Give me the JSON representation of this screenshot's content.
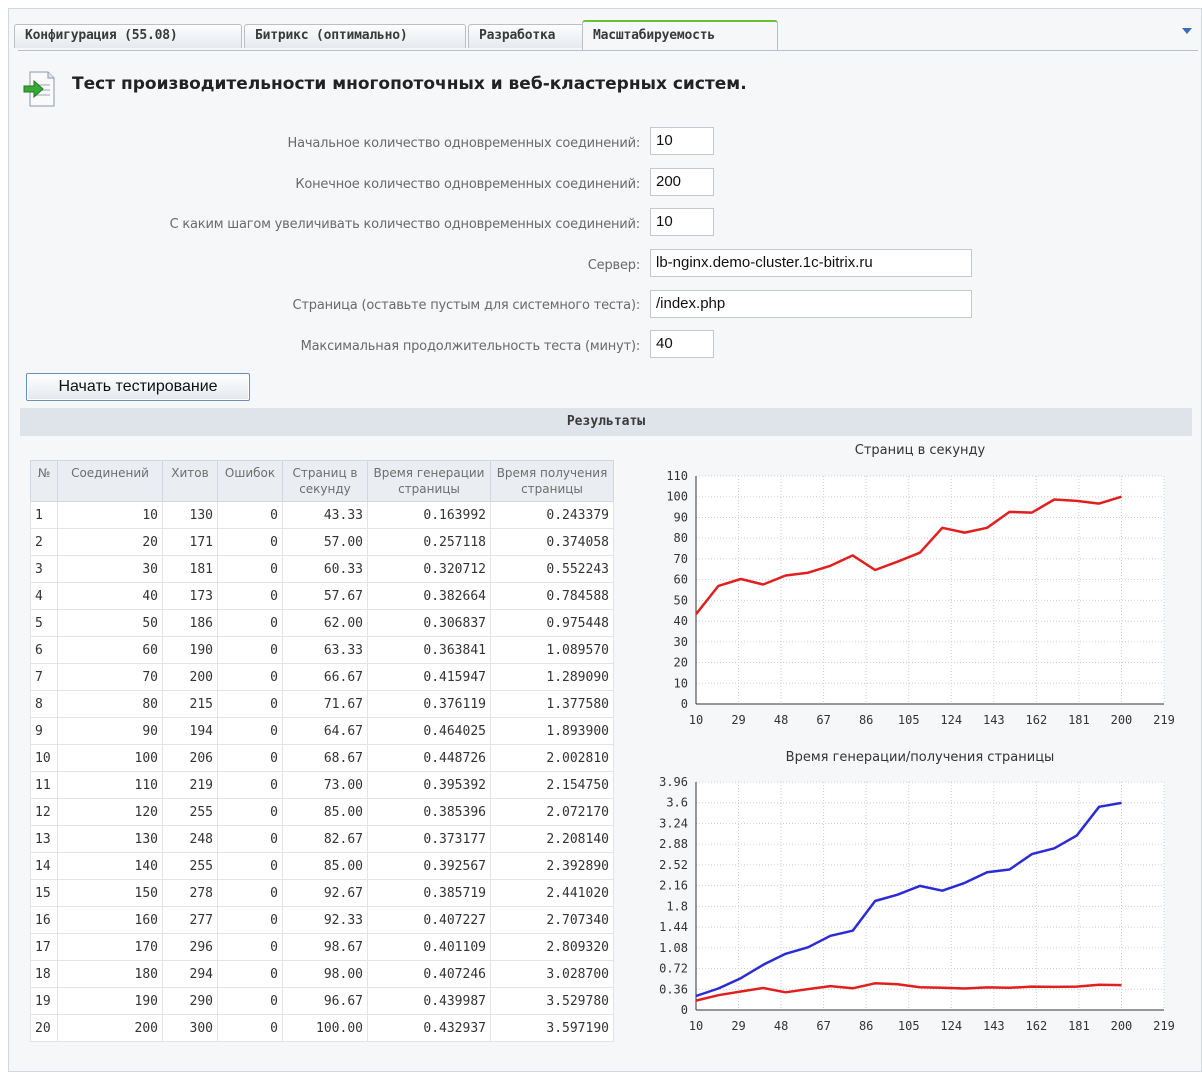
{
  "tabs": [
    {
      "label": "Конфигурация (55.08)"
    },
    {
      "label": "Битрикс (оптимально)"
    },
    {
      "label": "Разработка"
    },
    {
      "label": "Масштабируемость"
    }
  ],
  "page": {
    "title": "Тест производительности многопоточных и веб-кластерных систем."
  },
  "form": {
    "start_conn": {
      "label": "Начальное количество одновременных соединений:",
      "value": "10"
    },
    "end_conn": {
      "label": "Конечное количество одновременных соединений:",
      "value": "200"
    },
    "step": {
      "label": "С каким шагом увеличивать количество одновременных соединений:",
      "value": "10"
    },
    "server": {
      "label": "Сервер:",
      "value": "lb-nginx.demo-cluster.1c-bitrix.ru"
    },
    "page": {
      "label": "Страница (оставьте пустым для системного теста):",
      "value": "/index.php"
    },
    "duration": {
      "label": "Максимальная продолжительность теста (минут):",
      "value": "40"
    },
    "start_button": "Начать тестирование"
  },
  "results": {
    "title": "Результаты",
    "columns": [
      "№",
      "Соединений",
      "Хитов",
      "Ошибок",
      "Страниц в секунду",
      "Время генерации страницы",
      "Время получения страницы"
    ],
    "rows": [
      [
        "1",
        "10",
        "130",
        "0",
        "43.33",
        "0.163992",
        "0.243379"
      ],
      [
        "2",
        "20",
        "171",
        "0",
        "57.00",
        "0.257118",
        "0.374058"
      ],
      [
        "3",
        "30",
        "181",
        "0",
        "60.33",
        "0.320712",
        "0.552243"
      ],
      [
        "4",
        "40",
        "173",
        "0",
        "57.67",
        "0.382664",
        "0.784588"
      ],
      [
        "5",
        "50",
        "186",
        "0",
        "62.00",
        "0.306837",
        "0.975448"
      ],
      [
        "6",
        "60",
        "190",
        "0",
        "63.33",
        "0.363841",
        "1.089570"
      ],
      [
        "7",
        "70",
        "200",
        "0",
        "66.67",
        "0.415947",
        "1.289090"
      ],
      [
        "8",
        "80",
        "215",
        "0",
        "71.67",
        "0.376119",
        "1.377580"
      ],
      [
        "9",
        "90",
        "194",
        "0",
        "64.67",
        "0.464025",
        "1.893900"
      ],
      [
        "10",
        "100",
        "206",
        "0",
        "68.67",
        "0.448726",
        "2.002810"
      ],
      [
        "11",
        "110",
        "219",
        "0",
        "73.00",
        "0.395392",
        "2.154750"
      ],
      [
        "12",
        "120",
        "255",
        "0",
        "85.00",
        "0.385396",
        "2.072170"
      ],
      [
        "13",
        "130",
        "248",
        "0",
        "82.67",
        "0.373177",
        "2.208140"
      ],
      [
        "14",
        "140",
        "255",
        "0",
        "85.00",
        "0.392567",
        "2.392890"
      ],
      [
        "15",
        "150",
        "278",
        "0",
        "92.67",
        "0.385719",
        "2.441020"
      ],
      [
        "16",
        "160",
        "277",
        "0",
        "92.33",
        "0.407227",
        "2.707340"
      ],
      [
        "17",
        "170",
        "296",
        "0",
        "98.67",
        "0.401109",
        "2.809320"
      ],
      [
        "18",
        "180",
        "294",
        "0",
        "98.00",
        "0.407246",
        "3.028700"
      ],
      [
        "19",
        "190",
        "290",
        "0",
        "96.67",
        "0.439987",
        "3.529780"
      ],
      [
        "20",
        "200",
        "300",
        "0",
        "100.00",
        "0.432937",
        "3.597190"
      ]
    ]
  },
  "chart_data": [
    {
      "type": "line",
      "title": "Страниц в секунду",
      "xlabel": "",
      "ylabel": "",
      "x_ticks": [
        "10",
        "29",
        "48",
        "67",
        "86",
        "105",
        "124",
        "143",
        "162",
        "181",
        "200",
        "219"
      ],
      "y_ticks": [
        "0",
        "10",
        "20",
        "30",
        "40",
        "50",
        "60",
        "70",
        "80",
        "90",
        "100",
        "110"
      ],
      "xlim": [
        10,
        219
      ],
      "ylim": [
        0,
        110
      ],
      "grid": true,
      "x": [
        10,
        20,
        30,
        40,
        50,
        60,
        70,
        80,
        90,
        100,
        110,
        120,
        130,
        140,
        150,
        160,
        170,
        180,
        190,
        200
      ],
      "series": [
        {
          "color": "#e02020",
          "values": [
            43.33,
            57.0,
            60.33,
            57.67,
            62.0,
            63.33,
            66.67,
            71.67,
            64.67,
            68.67,
            73.0,
            85.0,
            82.67,
            85.0,
            92.67,
            92.33,
            98.67,
            98.0,
            96.67,
            100.0
          ]
        }
      ]
    },
    {
      "type": "line",
      "title": "Время генерации/получения страницы",
      "xlabel": "",
      "ylabel": "",
      "x_ticks": [
        "10",
        "29",
        "48",
        "67",
        "86",
        "105",
        "124",
        "143",
        "162",
        "181",
        "200",
        "219"
      ],
      "y_ticks": [
        "0",
        "0.36",
        "0.72",
        "1.08",
        "1.44",
        "1.8",
        "2.16",
        "2.52",
        "2.88",
        "3.24",
        "3.6",
        "3.96"
      ],
      "xlim": [
        10,
        219
      ],
      "ylim": [
        0,
        3.96
      ],
      "grid": true,
      "x": [
        10,
        20,
        30,
        40,
        50,
        60,
        70,
        80,
        90,
        100,
        110,
        120,
        130,
        140,
        150,
        160,
        170,
        180,
        190,
        200
      ],
      "series": [
        {
          "color": "#2b2bd6",
          "values": [
            0.243379,
            0.374058,
            0.552243,
            0.784588,
            0.975448,
            1.08957,
            1.28909,
            1.37758,
            1.8939,
            2.00281,
            2.15475,
            2.07217,
            2.20814,
            2.39289,
            2.44102,
            2.70734,
            2.80932,
            3.0287,
            3.52978,
            3.59719
          ]
        },
        {
          "color": "#e02020",
          "values": [
            0.163992,
            0.257118,
            0.320712,
            0.382664,
            0.306837,
            0.363841,
            0.415947,
            0.376119,
            0.464025,
            0.448726,
            0.395392,
            0.385396,
            0.373177,
            0.392567,
            0.385719,
            0.407227,
            0.401109,
            0.407246,
            0.439987,
            0.432937
          ]
        }
      ]
    }
  ]
}
